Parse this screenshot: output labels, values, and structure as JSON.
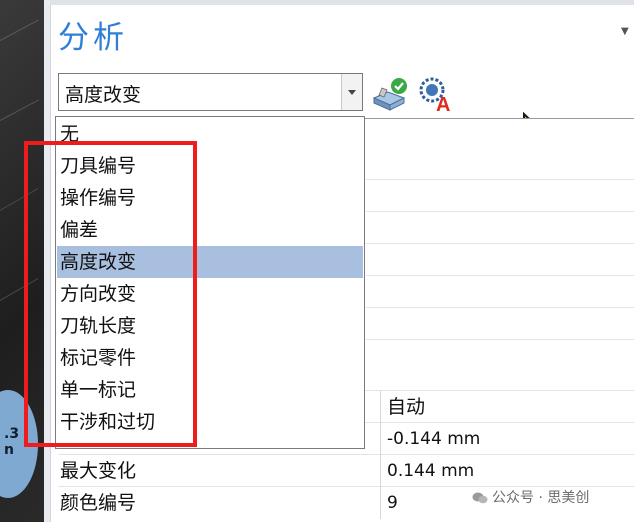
{
  "panel": {
    "title": "分析"
  },
  "combo": {
    "selected": "高度改变"
  },
  "dropdown": {
    "options": [
      "无",
      "刀具编号",
      "操作编号",
      "偏差",
      "高度改变",
      "方向改变",
      "刀轨长度",
      "标记零件",
      "单一标记",
      "干涉和过切"
    ],
    "selected_index": 4
  },
  "viewport": {
    "badge": ".3\nn"
  },
  "properties": [
    {
      "name": "",
      "value": "自动"
    },
    {
      "name": "",
      "value": "-0.144 mm"
    },
    {
      "name": "最大变化",
      "value": "0.144 mm"
    },
    {
      "name": "颜色编号",
      "value": "9"
    }
  ],
  "watermark": {
    "text": "公众号 · 思美创"
  },
  "colors": {
    "title_blue": "#2f7fd6",
    "selection": "#a9bfe0",
    "highlight_box": "#ee1c1c"
  }
}
